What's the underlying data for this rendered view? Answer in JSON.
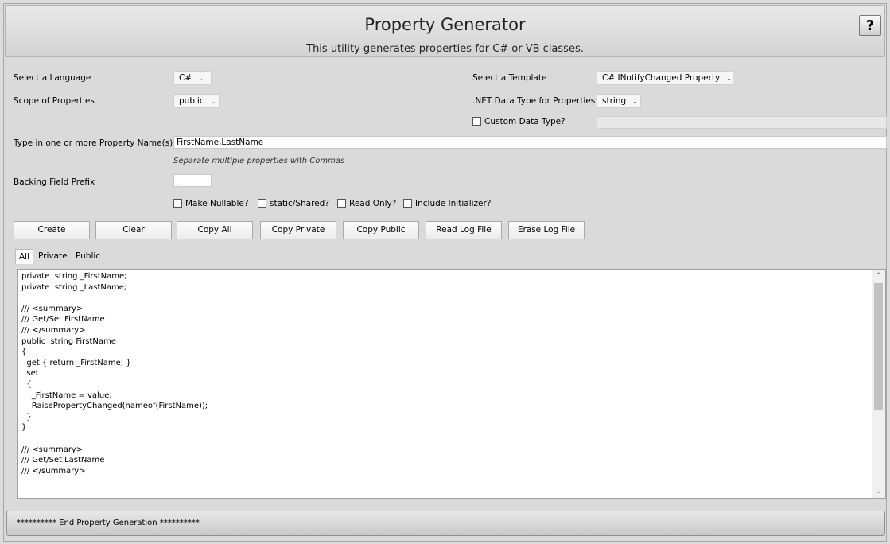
{
  "header": {
    "title": "Property Generator",
    "subtitle": "This utility generates properties for C# or VB classes.",
    "help_label": "?"
  },
  "form": {
    "language_label": "Select a Language",
    "language_value": "C#",
    "scope_label": "Scope of Properties",
    "scope_value": "public",
    "template_label": "Select a Template",
    "template_value": "C# INotifyChanged Property",
    "datatype_label": ".NET Data Type for Properties",
    "datatype_value": "string",
    "custom_type_label": "Custom Data Type?",
    "custom_type_checked": false,
    "custom_type_value": "",
    "property_names_label": "Type in one or more Property Name(s)",
    "property_names_value": "FirstName,LastName",
    "property_names_hint": "Separate multiple properties with Commas",
    "prefix_label": "Backing Field Prefix",
    "prefix_value": "_",
    "options": [
      {
        "label": "Make Nullable?",
        "checked": false
      },
      {
        "label": "static/Shared?",
        "checked": false
      },
      {
        "label": "Read Only?",
        "checked": false
      },
      {
        "label": "Include Initializer?",
        "checked": false
      }
    ]
  },
  "buttons": {
    "create": "Create",
    "clear": "Clear",
    "copy_all": "Copy All",
    "copy_private": "Copy Private",
    "copy_public": "Copy Public",
    "read_log": "Read Log File",
    "erase_log": "Erase Log File"
  },
  "tabs": [
    {
      "label": "All",
      "active": true
    },
    {
      "label": "Private",
      "active": false
    },
    {
      "label": "Public",
      "active": false
    }
  ],
  "output_code": "private  string _FirstName;\nprivate  string _LastName;\n\n/// <summary>\n/// Get/Set FirstName\n/// </summary>\npublic  string FirstName\n{\n  get { return _FirstName; }\n  set\n  {\n    _FirstName = value;\n    RaisePropertyChanged(nameof(FirstName));\n  }\n}\n\n/// <summary>\n/// Get/Set LastName\n/// </summary>",
  "status_text": "********** End Property Generation **********"
}
